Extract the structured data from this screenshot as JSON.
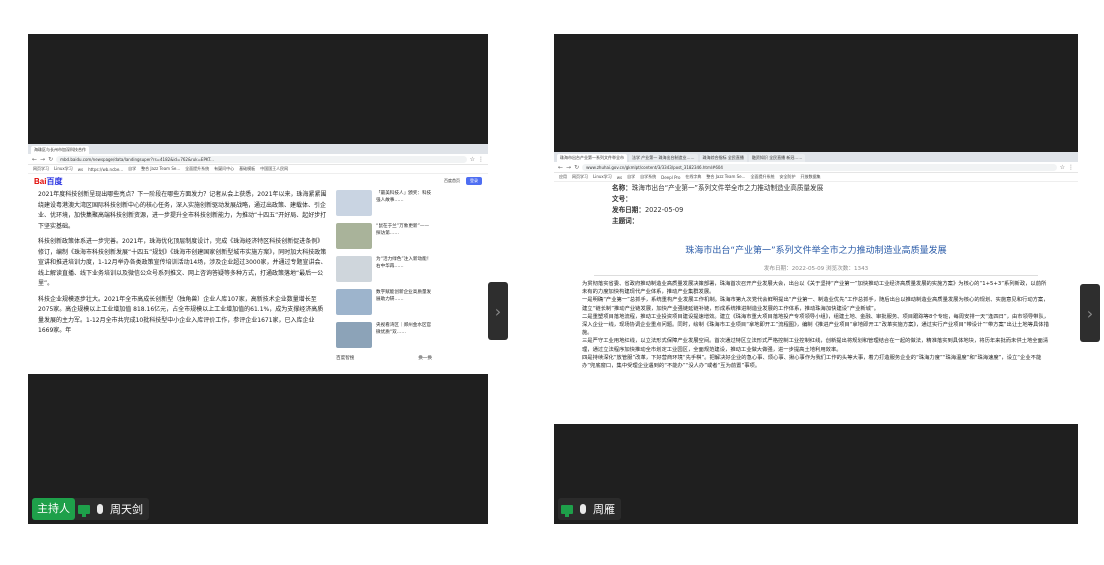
{
  "left_tile": {
    "browser": {
      "tab_title": "海珠区与长州市加深科技合作",
      "url": "mbd.baidu.com/newspage/data/landingsuper?rs=4182&id=762&ruk=EPKT...",
      "bookmarks": [
        "网页学习",
        "Linux学习",
        "ws",
        "https://wb.ncbe...",
        "自学",
        "整合 Jazz Team Se...",
        "全面提升系统",
        "有疑问中心",
        "基础模板",
        "中国国王人民网"
      ]
    },
    "baidu": {
      "logo_left": "Bai",
      "logo_right": "百度",
      "home_link": "百度首页",
      "login_button": "登录"
    },
    "article_paragraphs": [
      "2021年度科技创新呈现出哪些亮点？下一阶段在哪些方面发力？记者从会上获悉，2021年以来，珠海紧紧围绕建设粤港澳大湾区国际科技创新中心的核心任务，深入实施创新驱动发展战略，通过出政策、建载体、引企业、优环境，加快集聚高端科技创新资源，进一步提升全市科技创新能力，为推动“十四五”开好局、起好步打下坚实基础。",
      "科技创新政策体系进一步完善。2021年，珠海优化顶层制度设计，完成《珠海经济特区科技创新促进条例》修订，编制《珠海市科技创新发展“十四五”规划》《珠海市创建国家创新型城市实施方案》，同时加大科技政策宣讲和推进培训力度，1-12月举办各类政策宣传培训活动14场，涉及企业超过3000家，并通过专题宣讲会、线上解读直播、线下业务培训以及微信公众号系列推文、网上咨询答疑等多种方式，打通政策落地“最后一公里”。",
      "科技企业规模逐步壮大。2021年全市高成长创新型（独角兽）企业人库107家，高新技术企业数量增长至2075家。高企规模以上工业增加值 818.16亿元，占全市规模以上工业增加值的61.1%，成为支撑经济高质量发展的主力军。1-12月全市共完成10批科技型中小企业入库评价工作，参评企业1671家，已入库企业1669家。年"
    ],
    "rail_items": [
      "「最美科技人」颁奖：科技强人故事……",
      "“鼠在于兰”万象更新”——探访第……",
      "为“活力绿色”注入新动能！右中华再……",
      "数字赋能创新企业高质量发展助力研……",
      "央视看湾区｜郑州金水区官微优质“双……"
    ],
    "rail_footer_left": "百度智搜",
    "rail_footer_right": "换一换",
    "label": {
      "host_badge": "主持人",
      "name": "周天剑"
    }
  },
  "right_tile": {
    "browser": {
      "tabs": [
        "珠海市出台产业第一系列文件举全市",
        "法学 产业第一 珠海出台制造业……",
        "珠海综合指标 全民直播",
        "融资知识 全民直播 新冠……"
      ],
      "url": "www.zhuhai.gov.cn/gkmlpt/content/3/3343/post_3182346.html#604",
      "bookmarks": [
        "应用",
        "网页学习",
        "Linux学习",
        "ws",
        "自学",
        "自学系统",
        "Deepl Pro",
        "在线字典",
        "整合 Jazz Team Se...",
        "全面提升系统",
        "安全防护",
        "开放数据集"
      ]
    },
    "meta": [
      {
        "label": "名称：",
        "value": "珠海市出台“产业第一”系列文件举全市之力推动制造业高质量发展"
      },
      {
        "label": "文号：",
        "value": ""
      },
      {
        "label": "发布日期：",
        "value": "2022-05-09"
      },
      {
        "label": "主题词：",
        "value": ""
      }
    ],
    "title": "珠海市出台“产业第一”系列文件举全市之力推动制造业高质量发展",
    "date_line": "发布日期：2022-05-09    浏览次数：1343",
    "body_paragraphs": [
      "为贯彻落实省委、省政府推动制造业高质量发展决策部署，珠海首次召开产业发展大会，出台以《关于坚持“产业第一”加快推动工业经济高质量发展的实施方案》为核心的“1+5+3”系列新政，以前所未有的力度加快构建现代产业体系，推动产业集群发展。",
      "一是明确“产业第一”总抓手，系统重构产业发展工作机制。珠海市第九次党代会鲜明提出“产业第一、制造业优先”工作总抓手，随后出台以推动制造业高质量发展为核心的规划、实施意见和行动方案，建立“链长制”推动产业链发展，加快产业强链延链补链，形成系统推进制造业发展的工作体系，推动珠海加快建设“产业新城”。",
      "二是重塑项目落地流程，推动工业投资项目建设提速增效。建立《珠海市重大项目落地投产专项领导小组》，组建土地、金融、审批服务、项目跟踪等8个专班，每周安排一天“逢四日”，由市领导带队，深入企业一线，现场协调企业重点问题。同时，绘制《珠海市工业项目“拿地即开工”流程图》，编制《推进产业项目“拿地即开工”改革实施方案》，通过实行产业项目“带设计”“带方案”出让土地等具体措施。",
      "三是严守工业用地红线，以立法形式保障产业发展空间。首次通过特区立法形式严格控制工业控制红线，创新提出将规划和管理结合在一起的做法，精准落实到具体地块，将历年来批而未供土地全面清理，通过立法程序加快推动全市划定工业园区，全面规范建设，推动工业做大做强，进一步提高土地利用效率。",
      "四是持续深化“放管服”改革，下好营商环境“先手棋”。把解决好企业的急心事、烦心事、揪心事作为我们工作的头等大事，着力打造服务企业的“珠海力度”“珠海温度”和“珠海速度”，设立“企业不能办”兜底窗口，集中受理企业遇到的“不能办”“没人办”或者“互为前置”事项。"
    ],
    "label": {
      "name": "周雁"
    }
  },
  "colors": {
    "tile_bg": "#1f1f1f",
    "host_green": "#1ea04a",
    "gov_title_blue": "#2a5ba8",
    "baidu_blue": "#2932e1",
    "baidu_red": "#e10602"
  },
  "icons": [
    "tile-next-arrow-icon",
    "screen-share-icon",
    "microphone-icon"
  ]
}
